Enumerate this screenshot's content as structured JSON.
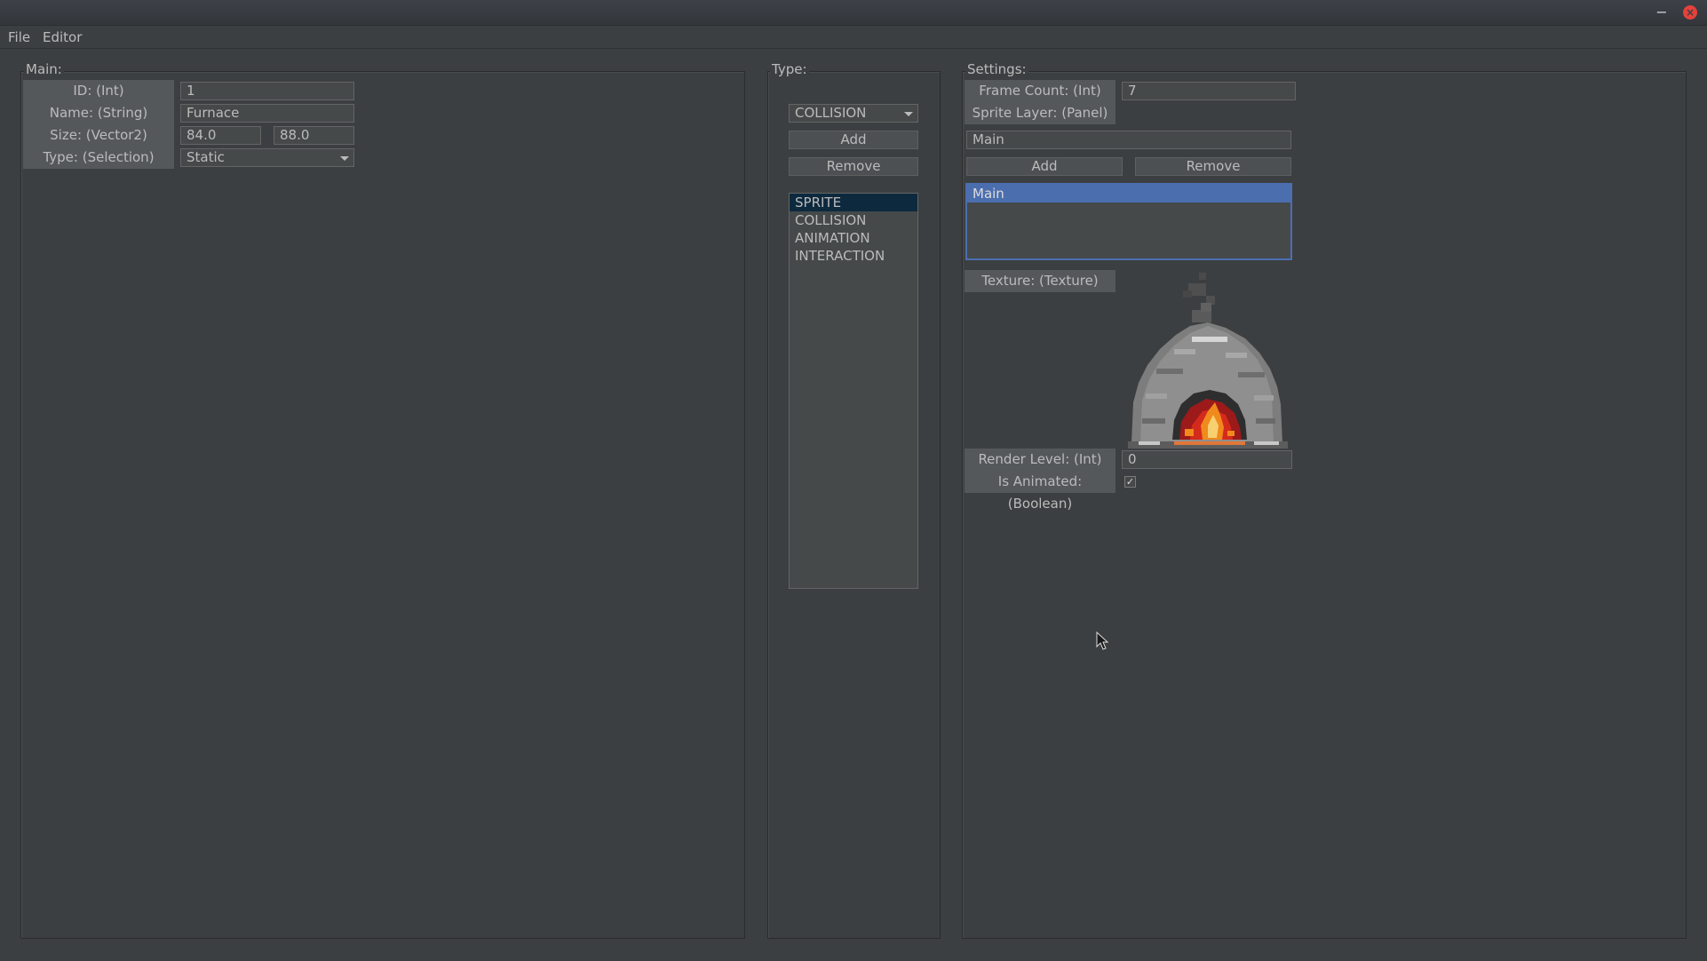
{
  "window": {
    "minimize_glyph": "−",
    "close_glyph": "×"
  },
  "menu": {
    "items": [
      "File",
      "Editor"
    ]
  },
  "main_panel": {
    "title": "Main:",
    "fields": [
      {
        "label": "ID: (Int)",
        "value": "1"
      },
      {
        "label": "Name: (String)",
        "value": "Furnace"
      },
      {
        "label": "Size: (Vector2)",
        "value_x": "84.0",
        "value_y": "88.0"
      },
      {
        "label": "Type: (Selection)",
        "value": "Static"
      }
    ]
  },
  "type_panel": {
    "title": "Type:",
    "selected_type": "COLLISION",
    "add_label": "Add",
    "remove_label": "Remove",
    "components": [
      "SPRITE",
      "COLLISION",
      "ANIMATION",
      "INTERACTION"
    ],
    "selected_index": 0
  },
  "settings_panel": {
    "title": "Settings:",
    "frame_count_label": "Frame Count: (Int)",
    "frame_count_value": "7",
    "sprite_layer_label": "Sprite Layer: (Panel)",
    "layer_name_value": "Main",
    "add_label": "Add",
    "remove_label": "Remove",
    "layers": [
      "Main"
    ],
    "texture_label": "Texture: (Texture)",
    "texture_icon": "furnace-sprite",
    "render_level_label": "Render Level: (Int)",
    "render_level_value": "0",
    "is_animated_label": "Is Animated: (Boolean)",
    "is_animated": true,
    "check_glyph": "✓"
  },
  "colors": {
    "background": "#3c3f41",
    "label_bg": "#55585b",
    "field_bg": "#45494a",
    "selection_blue": "#4b6eaf",
    "selection_dark": "#0d293e",
    "close_red": "#e5413c"
  }
}
